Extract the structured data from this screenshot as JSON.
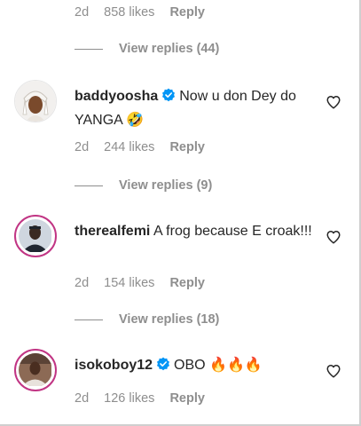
{
  "comments": [
    {
      "meta": {
        "time": "2d",
        "likes": "858 likes",
        "reply": "Reply"
      },
      "view_replies": "View replies (44)"
    },
    {
      "username": "baddyoosha",
      "verified": true,
      "text": "Now u don Dey do YANGA",
      "emoji": "🤣",
      "meta": {
        "time": "2d",
        "likes": "244 likes",
        "reply": "Reply"
      },
      "view_replies": "View replies (9)"
    },
    {
      "username": "therealfemi",
      "verified": false,
      "text": "A frog because E croak!!!",
      "meta": {
        "time": "2d",
        "likes": "154 likes",
        "reply": "Reply"
      },
      "view_replies": "View replies (18)"
    },
    {
      "username": "isokoboy12",
      "verified": true,
      "text": "OBO",
      "emoji": "🔥🔥🔥",
      "meta": {
        "time": "2d",
        "likes": "126 likes",
        "reply": "Reply"
      }
    }
  ],
  "icons": {
    "like": "heart-outline-icon",
    "verified": "verified-badge-icon"
  },
  "colors": {
    "muted": "#8e8e8e",
    "text": "#262626",
    "verified": "#0095f6",
    "story_ring": "#c13584"
  }
}
